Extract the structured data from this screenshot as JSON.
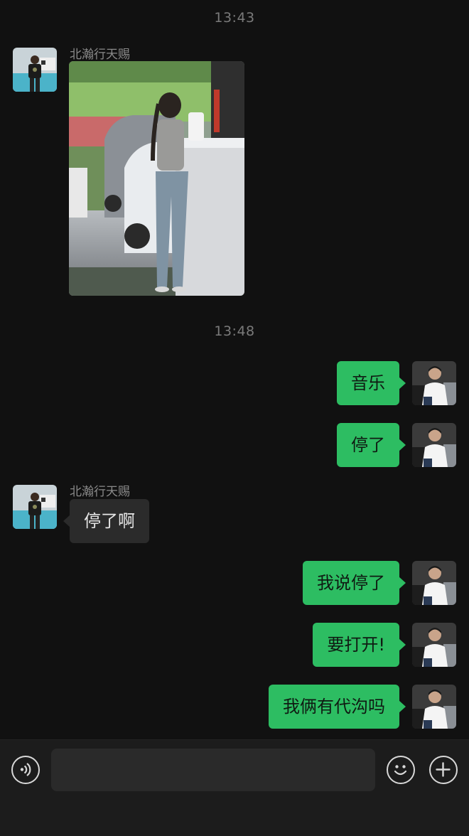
{
  "timestamps": [
    "13:43",
    "13:48"
  ],
  "contact": {
    "name": "北瀚行天赐",
    "avatar": "person-black-tshirt-blue-car-avatar"
  },
  "me": {
    "avatar": "person-white-shirt-car-interior-avatar"
  },
  "messages": {
    "m1": {
      "from": "contact",
      "type": "image",
      "image": "woman-standing-by-counter-photo"
    },
    "m2": {
      "from": "me",
      "text": "音乐"
    },
    "m3": {
      "from": "me",
      "text": "停了"
    },
    "m4": {
      "from": "contact",
      "text": "停了啊"
    },
    "m5": {
      "from": "me",
      "text": "我说停了"
    },
    "m6": {
      "from": "me",
      "text": "要打开!"
    },
    "m7": {
      "from": "me",
      "text": "我俩有代沟吗"
    }
  },
  "input_bar": {
    "voice_icon": "voice-icon",
    "message_value": "",
    "emoji_icon": "emoji-icon",
    "more_icon": "plus-icon"
  },
  "colors": {
    "background": "#111111",
    "outgoing_bubble": "#2dbd62",
    "incoming_bubble": "#2b2b2b",
    "input_bar": "#1c1c1c"
  }
}
